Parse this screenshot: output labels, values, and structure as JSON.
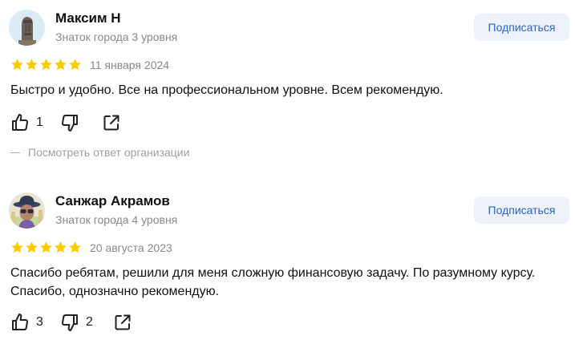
{
  "reviews": [
    {
      "author": "Максим Н",
      "level": "Знаток города 3 уровня",
      "subscribe_label": "Подписаться",
      "rating": 5,
      "date": "11 января 2024",
      "text": "Быстро и удобно. Все на профессиональном уровне. Всем рекомендую.",
      "likes": "1",
      "dislikes": "",
      "org_reply_link": "Посмотреть ответ организации",
      "avatar_icon": "moai-statue-icon"
    },
    {
      "author": "Санжар Акрамов",
      "level": "Знаток города 4 уровня",
      "subscribe_label": "Подписаться",
      "rating": 5,
      "date": "20 августа 2023",
      "text": "Спасибо ребятам, решили для меня сложную финансовую задачу. По разумному курсу. Спасибо, однозначно рекомендую.",
      "likes": "3",
      "dislikes": "2",
      "avatar_icon": "hat-person-avatar"
    }
  ],
  "colors": {
    "star": "#fc0",
    "subscribe_bg": "#eef3fb",
    "subscribe_text": "#2b63cc",
    "muted": "#8a8a8a"
  }
}
